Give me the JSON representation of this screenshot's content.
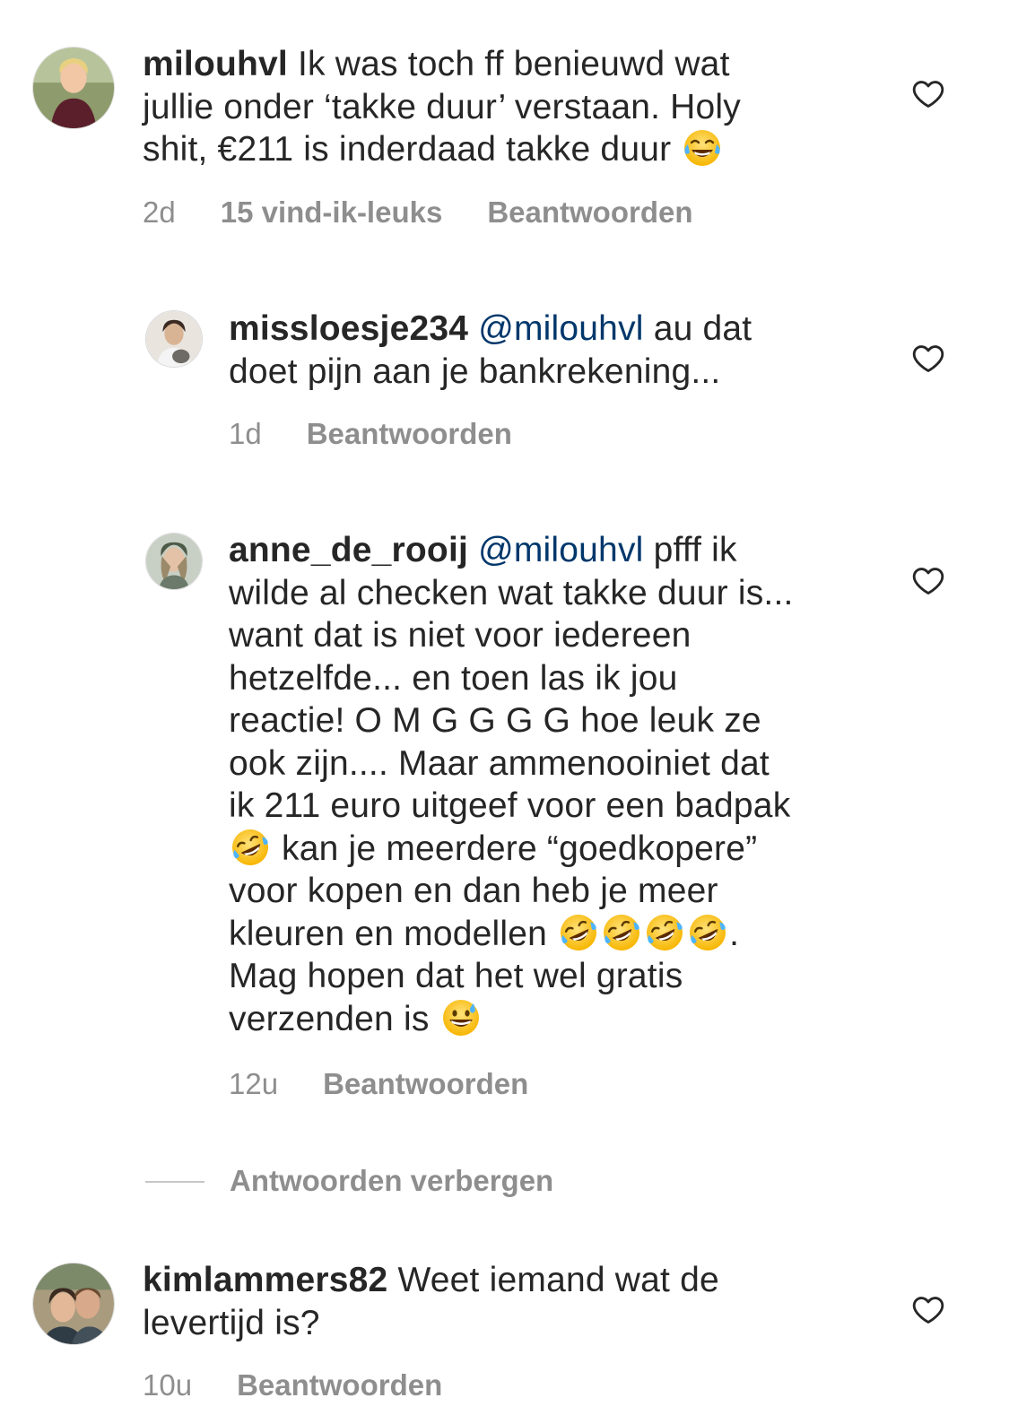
{
  "comments": [
    {
      "username": "milouhvl",
      "mention": "",
      "text": "Ik was toch ff benieuwd wat\njullie onder ‘takke duur’ verstaan. Holy\nshit, €211 is inderdaad takke duur",
      "time": "2d",
      "likes": "15 vind-ik-leuks",
      "reply_label": "Beantwoorden",
      "avatar_icon": "avatar-photo"
    },
    {
      "username": "missloesje234",
      "mention": "@milouhvl",
      "text": "au dat\ndoet pijn aan je bankrekening...",
      "time": "1d",
      "reply_label": "Beantwoorden",
      "avatar_icon": "avatar-photo"
    },
    {
      "username": "anne_de_rooij",
      "mention": "@milouhvl",
      "text_lines": [
        "pfff ik",
        "wilde al checken wat takke duur is...",
        "want dat is niet voor iedereen",
        "hetzelfde... en toen las ik jou",
        "reactie! O M G G G G hoe leuk ze",
        "ook zijn.... Maar ammenooiniet dat",
        "ik 211 euro uitgeef voor een badpak",
        "kan je meerdere “goedkopere”",
        "voor kopen en dan heb je meer",
        "kleuren en modellen",
        ".",
        "Mag hopen dat het wel gratis",
        "verzenden is"
      ],
      "time": "12u",
      "reply_label": "Beantwoorden",
      "avatar_icon": "avatar-photo"
    },
    {
      "username": "kimlammers82",
      "mention": "",
      "text": "Weet iemand wat de\nlevertijd is?",
      "time": "10u",
      "reply_label": "Beantwoorden",
      "avatar_icon": "avatar-photo"
    }
  ],
  "hide_replies_label": "Antwoorden verbergen",
  "like_icon": "heart-outline-icon",
  "emojis": {
    "joy": "face-with-tears-of-joy-emoji",
    "rofl": "rolling-on-the-floor-laughing-emoji",
    "sweat_smile": "grinning-face-with-sweat-emoji"
  },
  "colors": {
    "text": "#262626",
    "secondary": "#8e8e8e",
    "mention": "#00376b",
    "divider": "#c7c7c7"
  }
}
